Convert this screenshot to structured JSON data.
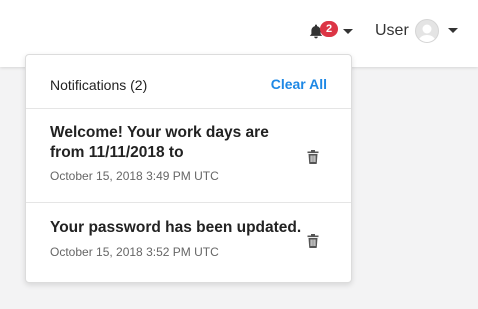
{
  "header": {
    "notifications_badge": "2",
    "user_label": "User"
  },
  "notifications_panel": {
    "title": "Notifications (2)",
    "clear_all_label": "Clear All",
    "items": [
      {
        "message": "Welcome! Your work days are from 11/11/2018 to",
        "timestamp": "October 15, 2018 3:49 PM UTC",
        "icon": "trash-icon"
      },
      {
        "message": "Your password has been updated.",
        "timestamp": "October 15, 2018 3:52 PM UTC",
        "icon": "trash-icon"
      }
    ]
  },
  "colors": {
    "badge": "#dc3545",
    "link": "#1e88e5",
    "background": "#f3f3f4"
  }
}
